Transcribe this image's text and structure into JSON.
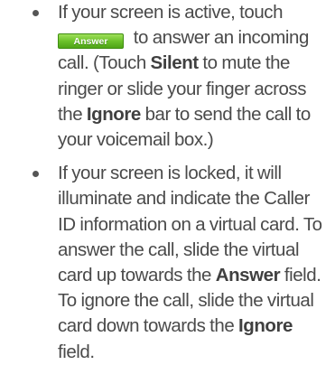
{
  "bullets": [
    {
      "segments": [
        {
          "text": "If your screen is active, touch "
        },
        {
          "answer_button": "Answer"
        },
        {
          "text": " to answer an incoming call. (Touch "
        },
        {
          "text": "Silent",
          "bold": true
        },
        {
          "text": " to mute the ringer or slide your finger across the "
        },
        {
          "text": "Ignore",
          "bold": true
        },
        {
          "text": " bar to send the call to your voicemail box.)"
        }
      ]
    },
    {
      "segments": [
        {
          "text": "If your screen is locked, it will illuminate and indicate the Caller ID information on a virtual card. To answer the call, slide the virtual card up towards the "
        },
        {
          "text": "Answer",
          "bold": true
        },
        {
          "text": " field. To ignore the call, slide the virtual card down towards the "
        },
        {
          "text": "Ignore",
          "bold": true
        },
        {
          "text": " field."
        }
      ]
    }
  ],
  "colors": {
    "text": "#4a4a4a",
    "bullet": "#555555",
    "answer_button_top": "#9fe05a",
    "answer_button_bottom": "#4fa517"
  }
}
